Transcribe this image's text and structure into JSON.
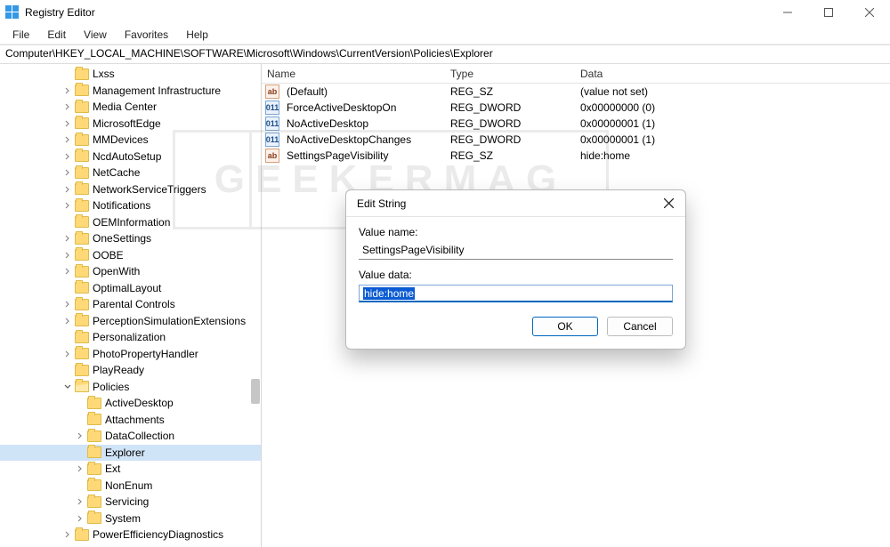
{
  "window": {
    "title": "Registry Editor",
    "min_icon": "minimize-icon",
    "max_icon": "maximize-icon",
    "close_icon": "close-icon"
  },
  "menu": {
    "file": "File",
    "edit": "Edit",
    "view": "View",
    "favorites": "Favorites",
    "help": "Help"
  },
  "address": "Computer\\HKEY_LOCAL_MACHINE\\SOFTWARE\\Microsoft\\Windows\\CurrentVersion\\Policies\\Explorer",
  "tree": [
    {
      "indent": 5,
      "label": "Lxss",
      "chev": false
    },
    {
      "indent": 5,
      "label": "Management Infrastructure",
      "chev": true
    },
    {
      "indent": 5,
      "label": "Media Center",
      "chev": true
    },
    {
      "indent": 5,
      "label": "MicrosoftEdge",
      "chev": true
    },
    {
      "indent": 5,
      "label": "MMDevices",
      "chev": true
    },
    {
      "indent": 5,
      "label": "NcdAutoSetup",
      "chev": true
    },
    {
      "indent": 5,
      "label": "NetCache",
      "chev": true
    },
    {
      "indent": 5,
      "label": "NetworkServiceTriggers",
      "chev": true
    },
    {
      "indent": 5,
      "label": "Notifications",
      "chev": true
    },
    {
      "indent": 5,
      "label": "OEMInformation",
      "chev": false
    },
    {
      "indent": 5,
      "label": "OneSettings",
      "chev": true
    },
    {
      "indent": 5,
      "label": "OOBE",
      "chev": true
    },
    {
      "indent": 5,
      "label": "OpenWith",
      "chev": true
    },
    {
      "indent": 5,
      "label": "OptimalLayout",
      "chev": false
    },
    {
      "indent": 5,
      "label": "Parental Controls",
      "chev": true
    },
    {
      "indent": 5,
      "label": "PerceptionSimulationExtensions",
      "chev": true
    },
    {
      "indent": 5,
      "label": "Personalization",
      "chev": false
    },
    {
      "indent": 5,
      "label": "PhotoPropertyHandler",
      "chev": true
    },
    {
      "indent": 5,
      "label": "PlayReady",
      "chev": false
    },
    {
      "indent": 5,
      "label": "Policies",
      "chev": true,
      "open": true
    },
    {
      "indent": 6,
      "label": "ActiveDesktop",
      "chev": false
    },
    {
      "indent": 6,
      "label": "Attachments",
      "chev": false
    },
    {
      "indent": 6,
      "label": "DataCollection",
      "chev": true
    },
    {
      "indent": 6,
      "label": "Explorer",
      "chev": false,
      "selected": true
    },
    {
      "indent": 6,
      "label": "Ext",
      "chev": true
    },
    {
      "indent": 6,
      "label": "NonEnum",
      "chev": false
    },
    {
      "indent": 6,
      "label": "Servicing",
      "chev": true
    },
    {
      "indent": 6,
      "label": "System",
      "chev": true
    },
    {
      "indent": 5,
      "label": "PowerEfficiencyDiagnostics",
      "chev": true
    }
  ],
  "list": {
    "cols": {
      "name": "Name",
      "type": "Type",
      "data": "Data"
    },
    "rows": [
      {
        "icon": "sz",
        "name": "(Default)",
        "type": "REG_SZ",
        "data": "(value not set)"
      },
      {
        "icon": "dw",
        "name": "ForceActiveDesktopOn",
        "type": "REG_DWORD",
        "data": "0x00000000 (0)"
      },
      {
        "icon": "dw",
        "name": "NoActiveDesktop",
        "type": "REG_DWORD",
        "data": "0x00000001 (1)"
      },
      {
        "icon": "dw",
        "name": "NoActiveDesktopChanges",
        "type": "REG_DWORD",
        "data": "0x00000001 (1)"
      },
      {
        "icon": "sz",
        "name": "SettingsPageVisibility",
        "type": "REG_SZ",
        "data": "hide:home"
      }
    ]
  },
  "dialog": {
    "title": "Edit String",
    "value_name_label": "Value name:",
    "value_name": "SettingsPageVisibility",
    "value_data_label": "Value data:",
    "value_data": "hide:home",
    "ok": "OK",
    "cancel": "Cancel"
  },
  "watermark": "GEEKERMAG"
}
